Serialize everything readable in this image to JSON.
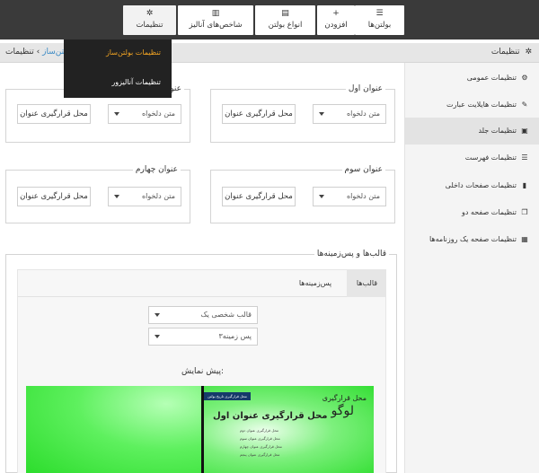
{
  "topbar": {
    "tabs": [
      {
        "label": "بولتن‌ها",
        "icon": "list-icon"
      },
      {
        "label": "افزودن",
        "icon": "plus-icon"
      },
      {
        "label": "انواع بولتن",
        "icon": "file-icon"
      },
      {
        "label": "شاخص‌های آنالیز",
        "icon": "bar-chart-icon"
      },
      {
        "label": "تنظیمات",
        "icon": "gear-icon"
      }
    ],
    "icon_glyphs": {
      "list": "☰",
      "plus": "+",
      "file": "▤",
      "chart": "▥",
      "gear": "✲"
    }
  },
  "dropdown": {
    "items": [
      {
        "label": "تنظیمات بولتن‌ساز",
        "highlight_color": "#f5a623"
      },
      {
        "label": "تنظیمات آنالیزور"
      }
    ]
  },
  "breadcrumb": {
    "link": "بولتن‌ساز",
    "separator": "›",
    "current": "تنظیمات",
    "page_title": "تنظیمات",
    "page_icon": "gear-icon",
    "page_icon_glyph": "✲"
  },
  "sidebar": {
    "items": [
      {
        "label": "تنظیمات عمومی",
        "icon": "gears-icon",
        "glyph": "⚙"
      },
      {
        "label": "تنظیمات هایلایت عبارت",
        "icon": "pencil-icon",
        "glyph": "✎"
      },
      {
        "label": "تنظیمات جلد",
        "icon": "image-icon",
        "glyph": "▣",
        "active": true
      },
      {
        "label": "تنظیمات فهرست",
        "icon": "list-icon",
        "glyph": "☰"
      },
      {
        "label": "تنظیمات صفحات داخلی",
        "icon": "book-icon",
        "glyph": "▮"
      },
      {
        "label": "تنظیمات صفحه دو",
        "icon": "copy-icon",
        "glyph": "❐"
      },
      {
        "label": "تنظیمات صفحه یک روزنامه‌ها",
        "icon": "grid-icon",
        "glyph": "▦"
      }
    ]
  },
  "titles": {
    "field_label": "محل قرارگیری عنوان",
    "select_value": "متن دلخواه",
    "panels": [
      {
        "title": "عنوان اول"
      },
      {
        "title": "عنوان دوم"
      },
      {
        "title": "عنوان سوم"
      },
      {
        "title": "عنوان چهارم"
      }
    ]
  },
  "themes": {
    "title": "قالب‌ها و پس‌زمینه‌ها",
    "tabs": [
      {
        "label": "قالب‌ها",
        "selected": true
      },
      {
        "label": "پس‌زمینه‌ها",
        "selected": false
      }
    ],
    "theme_select": "قالب شخصی یک",
    "background_select": "پس زمینه۳",
    "preview_label": "پیش نمایش:"
  },
  "preview": {
    "badge": "محل قرارگیری تاریخ بولتن",
    "logo_place": "محل قرارگیری",
    "logo": "لوگو",
    "headline": "محل قرارگیری عنوان اول",
    "lines": [
      "محل قرارگیری عنوان دوم",
      "محل قرارگیری عنوان سوم",
      "محل قرارگیری عنوان چهارم",
      "محل قرارگیری عنوان پنجم"
    ]
  },
  "colors": {
    "topbar_bg": "#3a3a3a",
    "dropdown_bg": "#222222",
    "link": "#3b8ac4",
    "preview_green": "#2bdc2b"
  }
}
